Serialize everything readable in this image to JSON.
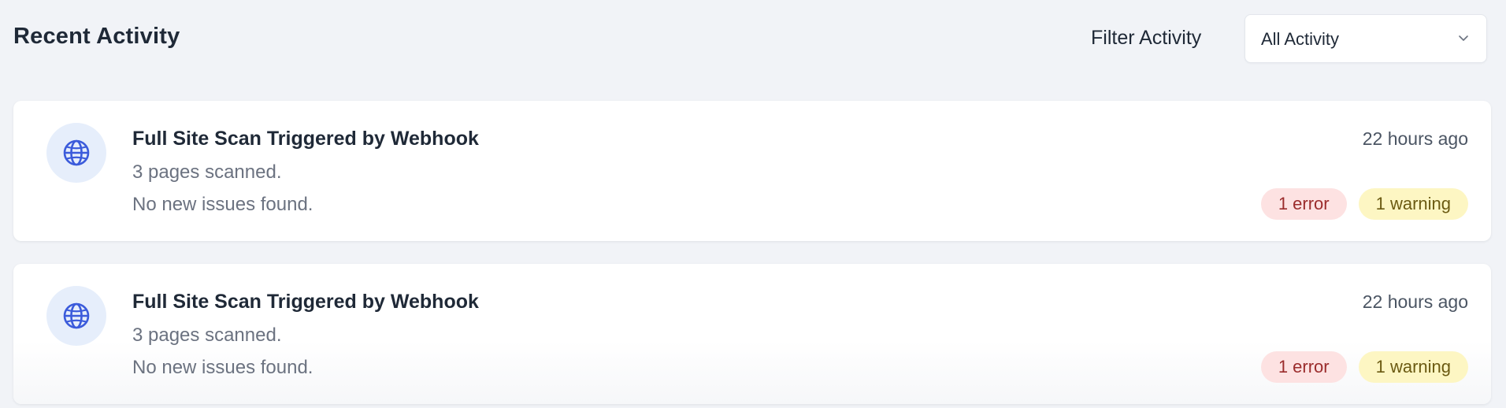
{
  "header": {
    "title": "Recent Activity",
    "filter_label": "Filter Activity",
    "filter_value": "All Activity"
  },
  "activities": [
    {
      "icon": "globe-icon",
      "title": "Full Site Scan Triggered by Webhook",
      "line1": "3 pages scanned.",
      "line2": "No new issues found.",
      "time": "22 hours ago",
      "error_badge": "1 error",
      "warning_badge": "1 warning"
    },
    {
      "icon": "globe-icon",
      "title": "Full Site Scan Triggered by Webhook",
      "line1": "3 pages scanned.",
      "line2": "No new issues found.",
      "time": "22 hours ago",
      "error_badge": "1 error",
      "warning_badge": "1 warning"
    }
  ],
  "colors": {
    "background": "#f1f3f7",
    "icon_bg": "#e6eefb",
    "icon_stroke": "#3b5bdb",
    "error_bg": "#fde2e2",
    "error_text": "#9b2c2c",
    "warning_bg": "#fdf6c3",
    "warning_text": "#6b5a12"
  }
}
